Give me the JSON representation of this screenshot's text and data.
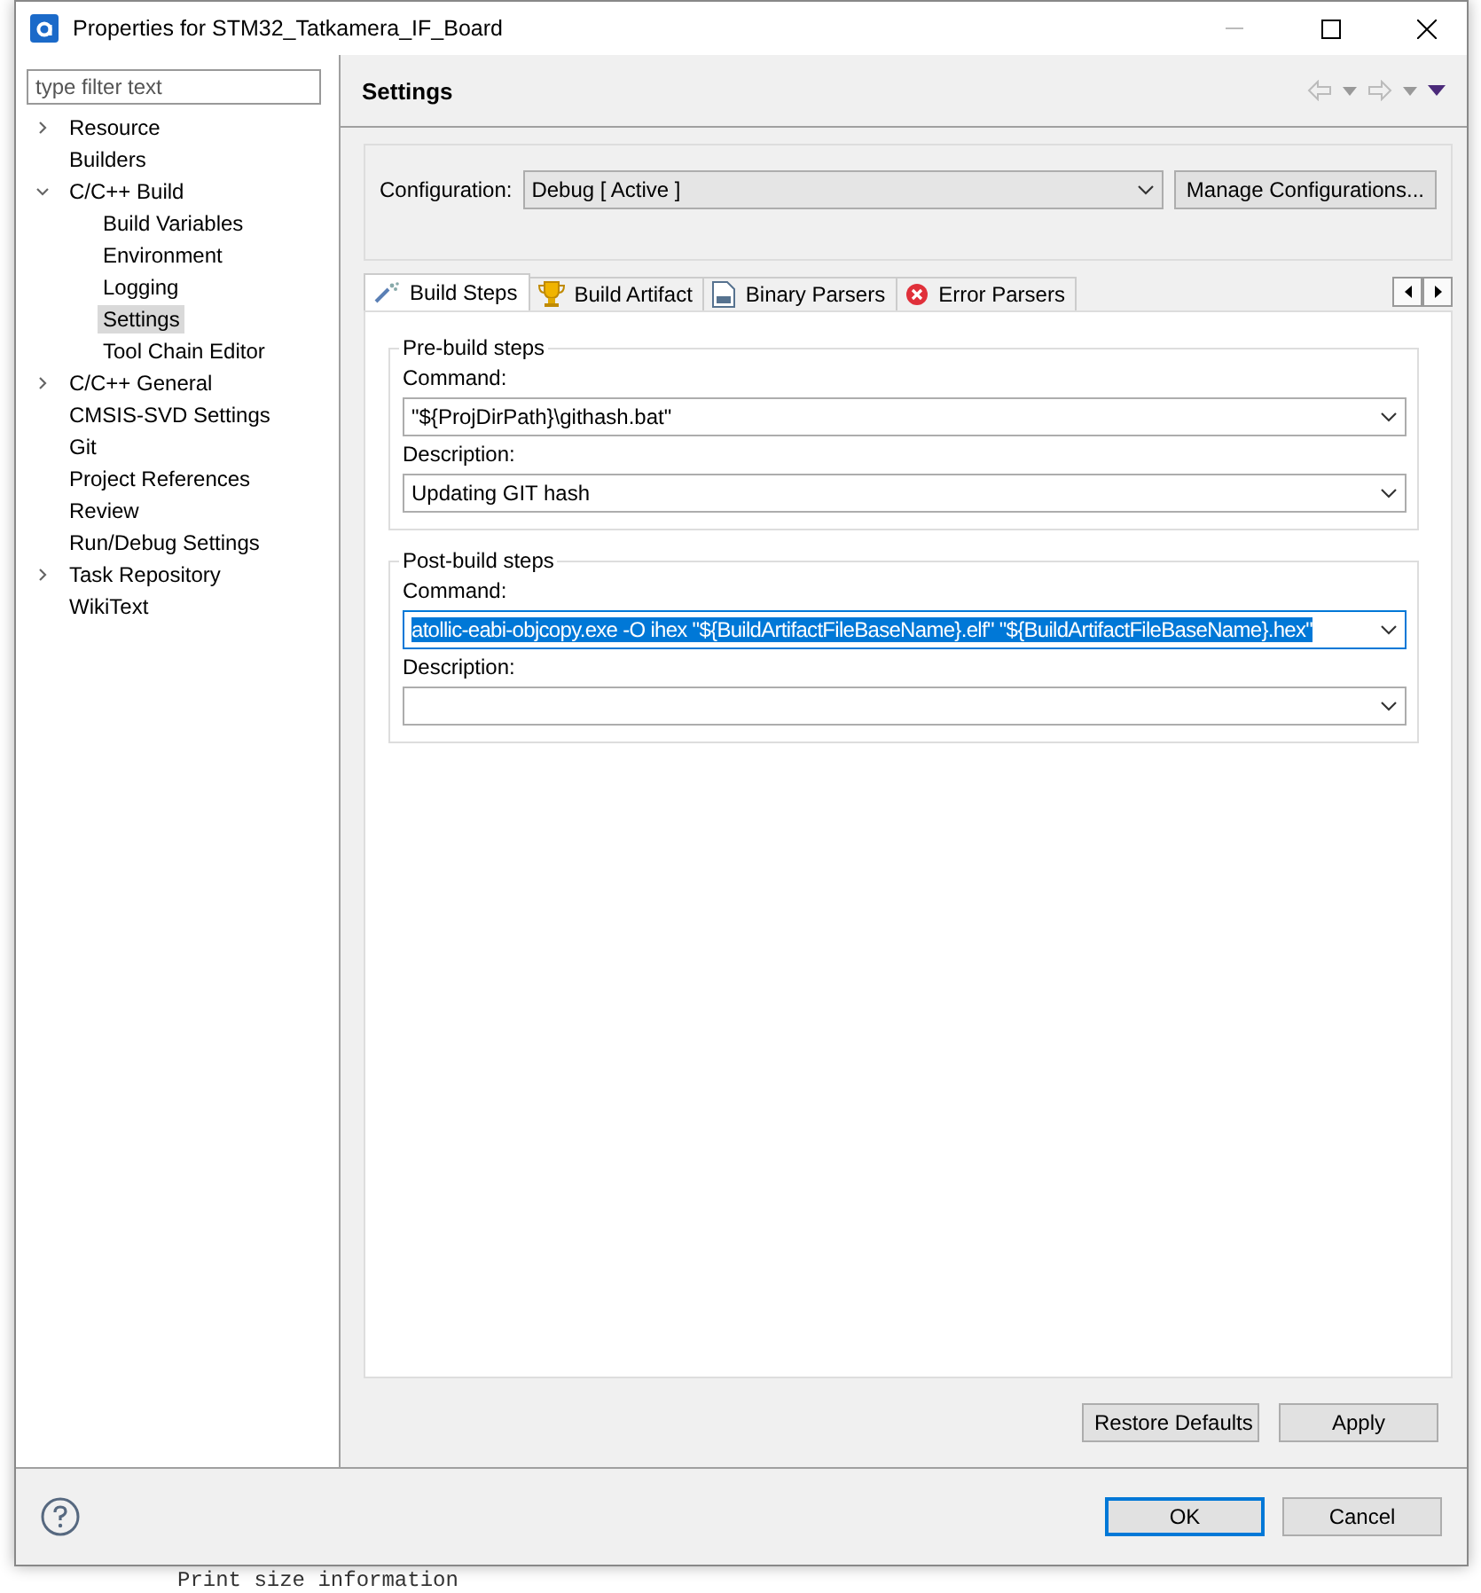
{
  "window": {
    "title": "Properties for STM32_Tatkamera_IF_Board"
  },
  "filter": {
    "placeholder": "type filter text"
  },
  "tree": [
    {
      "label": "Resource",
      "expanded": false,
      "selected": false
    },
    {
      "label": "Builders",
      "selected": false
    },
    {
      "label": "C/C++ Build",
      "expanded": true,
      "selected": false,
      "children": [
        {
          "label": "Build Variables",
          "selected": false
        },
        {
          "label": "Environment",
          "selected": false
        },
        {
          "label": "Logging",
          "selected": false
        },
        {
          "label": "Settings",
          "selected": true
        },
        {
          "label": "Tool Chain Editor",
          "selected": false
        }
      ]
    },
    {
      "label": "C/C++ General",
      "expanded": false,
      "selected": false
    },
    {
      "label": "CMSIS-SVD Settings",
      "selected": false
    },
    {
      "label": "Git",
      "selected": false
    },
    {
      "label": "Project References",
      "selected": false
    },
    {
      "label": "Review",
      "selected": false
    },
    {
      "label": "Run/Debug Settings",
      "selected": false
    },
    {
      "label": "Task Repository",
      "expanded": false,
      "selected": false
    },
    {
      "label": "WikiText",
      "selected": false
    }
  ],
  "page": {
    "title": "Settings"
  },
  "configuration": {
    "label": "Configuration:",
    "value": "Debug  [ Active ]",
    "button": "Manage Configurations..."
  },
  "tabs": [
    {
      "label": "Build Steps",
      "selected": true
    },
    {
      "label": "Build Artifact",
      "selected": false
    },
    {
      "label": "Binary Parsers",
      "selected": false
    },
    {
      "label": "Error Parsers",
      "selected": false
    }
  ],
  "groups": [
    {
      "title": "Pre-build steps",
      "fields": [
        {
          "label": "Command:",
          "value": "\"${ProjDirPath}\\githash.bat\"",
          "selected": false
        },
        {
          "label": "Description:",
          "value": "Updating GIT hash",
          "selected": false
        }
      ]
    },
    {
      "title": "Post-build steps",
      "fields": [
        {
          "label": "Command:",
          "value": "atollic-eabi-objcopy.exe -O ihex \"${BuildArtifactFileBaseName}.elf\" \"${BuildArtifactFileBaseName}.hex\"",
          "selected": true
        },
        {
          "label": "Description:",
          "selected": false
        }
      ]
    }
  ],
  "page_buttons": [
    "Restore Defaults",
    "Apply"
  ],
  "dialog_buttons": [
    {
      "label": "OK",
      "default": true
    },
    {
      "label": "Cancel",
      "default": false
    }
  ],
  "background_text": "Print size information"
}
